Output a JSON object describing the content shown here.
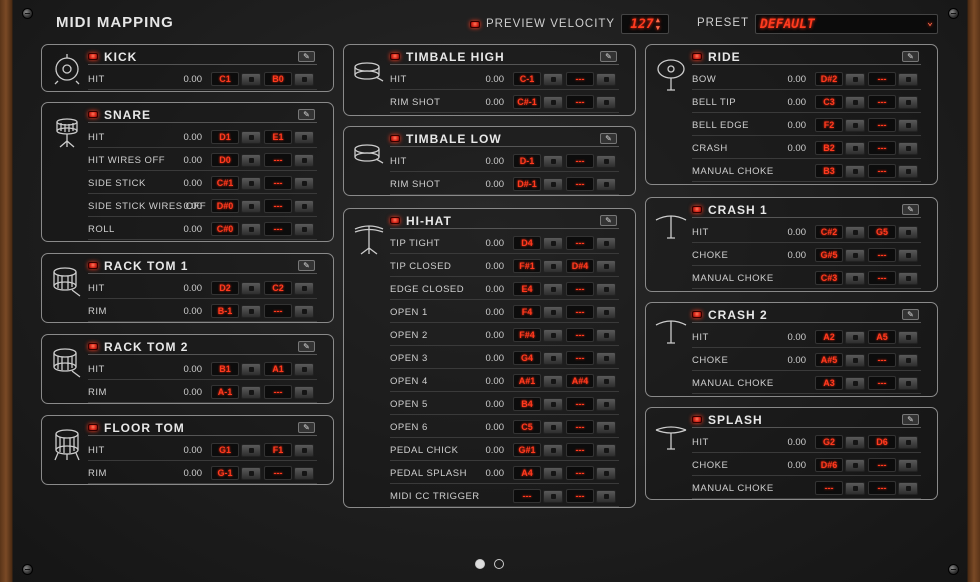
{
  "header": {
    "title": "MIDI MAPPING",
    "preview_velocity_label": "PREVIEW VELOCITY",
    "velocity_value": "127",
    "preset_label": "PRESET",
    "preset_value": "DEFAULT"
  },
  "colors": {
    "led": "#d8261a",
    "lcd_text": "#ff3b1f",
    "panel_border": "#8a8a8a",
    "wood": "#7a4a26"
  },
  "pagination": {
    "count": 2,
    "active": 0
  },
  "panels": [
    {
      "id": "kick",
      "name": "KICK",
      "icon": "kick-drum-icon",
      "rows": [
        {
          "label": "HIT",
          "value": "0.00",
          "n1": "C1",
          "n2": "B0"
        }
      ]
    },
    {
      "id": "snare",
      "name": "SNARE",
      "icon": "snare-drum-icon",
      "rows": [
        {
          "label": "HIT",
          "value": "0.00",
          "n1": "D1",
          "n2": "E1"
        },
        {
          "label": "HIT WIRES OFF",
          "value": "0.00",
          "n1": "D0",
          "n2": "---"
        },
        {
          "label": "SIDE STICK",
          "value": "0.00",
          "n1": "C#1",
          "n2": "---"
        },
        {
          "label": "SIDE STICK WIRES OFF",
          "value": "0.00",
          "n1": "D#0",
          "n2": "---"
        },
        {
          "label": "ROLL",
          "value": "0.00",
          "n1": "C#0",
          "n2": "---"
        }
      ]
    },
    {
      "id": "rack-tom-1",
      "name": "RACK TOM 1",
      "icon": "rack-tom-icon",
      "rows": [
        {
          "label": "HIT",
          "value": "0.00",
          "n1": "D2",
          "n2": "C2"
        },
        {
          "label": "RIM",
          "value": "0.00",
          "n1": "B-1",
          "n2": "---"
        }
      ]
    },
    {
      "id": "rack-tom-2",
      "name": "RACK TOM 2",
      "icon": "rack-tom-icon",
      "rows": [
        {
          "label": "HIT",
          "value": "0.00",
          "n1": "B1",
          "n2": "A1"
        },
        {
          "label": "RIM",
          "value": "0.00",
          "n1": "A-1",
          "n2": "---"
        }
      ]
    },
    {
      "id": "floor-tom",
      "name": "FLOOR TOM",
      "icon": "floor-tom-icon",
      "rows": [
        {
          "label": "HIT",
          "value": "0.00",
          "n1": "G1",
          "n2": "F1"
        },
        {
          "label": "RIM",
          "value": "0.00",
          "n1": "G-1",
          "n2": "---"
        }
      ]
    },
    {
      "id": "timbale-high",
      "name": "TIMBALE HIGH",
      "icon": "timbale-icon",
      "rows": [
        {
          "label": "HIT",
          "value": "0.00",
          "n1": "C-1",
          "n2": "---"
        },
        {
          "label": "RIM SHOT",
          "value": "0.00",
          "n1": "C#-1",
          "n2": "---"
        }
      ]
    },
    {
      "id": "timbale-low",
      "name": "TIMBALE LOW",
      "icon": "timbale-icon",
      "rows": [
        {
          "label": "HIT",
          "value": "0.00",
          "n1": "D-1",
          "n2": "---"
        },
        {
          "label": "RIM SHOT",
          "value": "0.00",
          "n1": "D#-1",
          "n2": "---"
        }
      ]
    },
    {
      "id": "hi-hat",
      "name": "HI-HAT",
      "icon": "hi-hat-icon",
      "rows": [
        {
          "label": "TIP TIGHT",
          "value": "0.00",
          "n1": "D4",
          "n2": "---"
        },
        {
          "label": "TIP CLOSED",
          "value": "0.00",
          "n1": "F#1",
          "n2": "D#4"
        },
        {
          "label": "EDGE CLOSED",
          "value": "0.00",
          "n1": "E4",
          "n2": "---"
        },
        {
          "label": "OPEN 1",
          "value": "0.00",
          "n1": "F4",
          "n2": "---"
        },
        {
          "label": "OPEN 2",
          "value": "0.00",
          "n1": "F#4",
          "n2": "---"
        },
        {
          "label": "OPEN 3",
          "value": "0.00",
          "n1": "G4",
          "n2": "---"
        },
        {
          "label": "OPEN 4",
          "value": "0.00",
          "n1": "A#1",
          "n2": "A#4"
        },
        {
          "label": "OPEN 5",
          "value": "0.00",
          "n1": "B4",
          "n2": "---"
        },
        {
          "label": "OPEN 6",
          "value": "0.00",
          "n1": "C5",
          "n2": "---"
        },
        {
          "label": "PEDAL CHICK",
          "value": "0.00",
          "n1": "G#1",
          "n2": "---"
        },
        {
          "label": "PEDAL SPLASH",
          "value": "0.00",
          "n1": "A4",
          "n2": "---"
        },
        {
          "label": "MIDI CC TRIGGER",
          "value": "",
          "n1": "---",
          "n2": "---"
        }
      ]
    },
    {
      "id": "ride",
      "name": "RIDE",
      "icon": "ride-cymbal-icon",
      "rows": [
        {
          "label": "BOW",
          "value": "0.00",
          "n1": "D#2",
          "n2": "---"
        },
        {
          "label": "BELL TIP",
          "value": "0.00",
          "n1": "C3",
          "n2": "---"
        },
        {
          "label": "BELL EDGE",
          "value": "0.00",
          "n1": "F2",
          "n2": "---"
        },
        {
          "label": "CRASH",
          "value": "0.00",
          "n1": "B2",
          "n2": "---"
        },
        {
          "label": "MANUAL CHOKE",
          "value": "",
          "n1": "B3",
          "n2": "---"
        }
      ]
    },
    {
      "id": "crash-1",
      "name": "CRASH 1",
      "icon": "crash-cymbal-icon",
      "rows": [
        {
          "label": "HIT",
          "value": "0.00",
          "n1": "C#2",
          "n2": "G5"
        },
        {
          "label": "CHOKE",
          "value": "0.00",
          "n1": "G#5",
          "n2": "---"
        },
        {
          "label": "MANUAL CHOKE",
          "value": "",
          "n1": "C#3",
          "n2": "---"
        }
      ]
    },
    {
      "id": "crash-2",
      "name": "CRASH 2",
      "icon": "crash-cymbal-icon",
      "rows": [
        {
          "label": "HIT",
          "value": "0.00",
          "n1": "A2",
          "n2": "A5"
        },
        {
          "label": "CHOKE",
          "value": "0.00",
          "n1": "A#5",
          "n2": "---"
        },
        {
          "label": "MANUAL CHOKE",
          "value": "",
          "n1": "A3",
          "n2": "---"
        }
      ]
    },
    {
      "id": "splash",
      "name": "SPLASH",
      "icon": "splash-cymbal-icon",
      "rows": [
        {
          "label": "HIT",
          "value": "0.00",
          "n1": "G2",
          "n2": "D6"
        },
        {
          "label": "CHOKE",
          "value": "0.00",
          "n1": "D#6",
          "n2": "---"
        },
        {
          "label": "MANUAL CHOKE",
          "value": "",
          "n1": "---",
          "n2": "---"
        }
      ]
    }
  ]
}
